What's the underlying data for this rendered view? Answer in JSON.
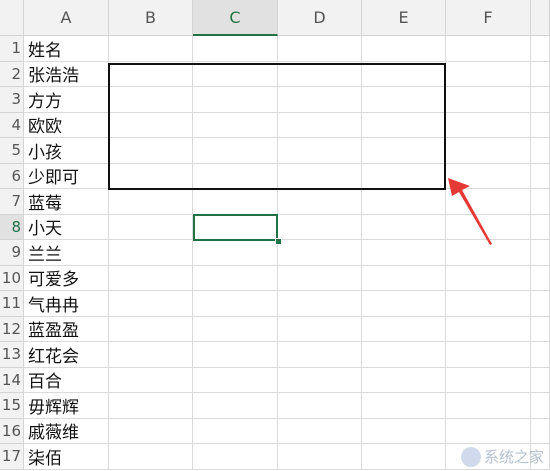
{
  "columns": [
    "A",
    "B",
    "C",
    "D",
    "E",
    "F"
  ],
  "active_column": "C",
  "rows": [
    {
      "num": "1",
      "a": "姓名"
    },
    {
      "num": "2",
      "a": "张浩浩"
    },
    {
      "num": "3",
      "a": "方方"
    },
    {
      "num": "4",
      "a": "欧欧"
    },
    {
      "num": "5",
      "a": "小孩"
    },
    {
      "num": "6",
      "a": "少即可"
    },
    {
      "num": "7",
      "a": "蓝莓"
    },
    {
      "num": "8",
      "a": "小天"
    },
    {
      "num": "9",
      "a": "兰兰"
    },
    {
      "num": "10",
      "a": "可爱多"
    },
    {
      "num": "11",
      "a": "气冉冉"
    },
    {
      "num": "12",
      "a": "蓝盈盈"
    },
    {
      "num": "13",
      "a": "红花会"
    },
    {
      "num": "14",
      "a": "百合"
    },
    {
      "num": "15",
      "a": "毋辉辉"
    },
    {
      "num": "16",
      "a": "戚薇维"
    },
    {
      "num": "17",
      "a": "柒佰"
    }
  ],
  "active_row": "8",
  "watermark": {
    "text": "系统之家"
  },
  "colors": {
    "accent": "#217346",
    "arrow": "#e53935",
    "box": "#111111"
  }
}
